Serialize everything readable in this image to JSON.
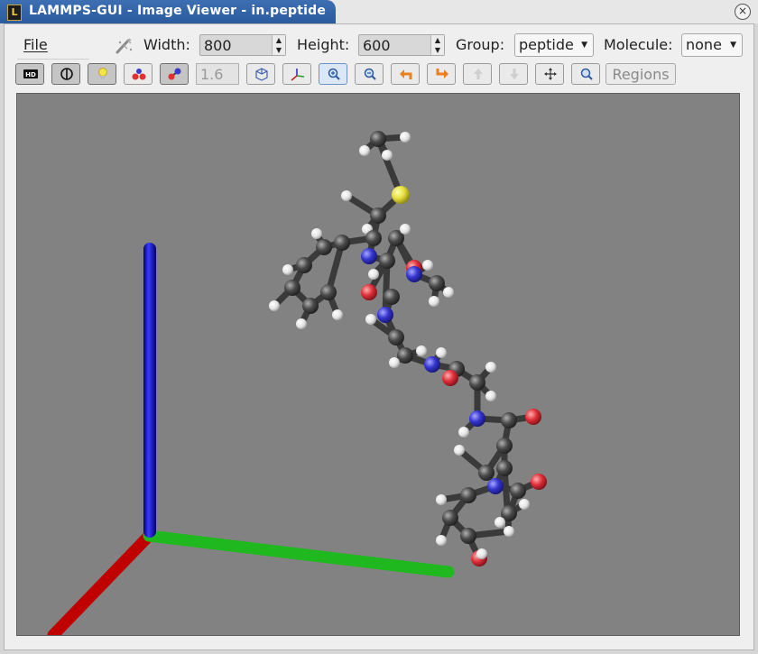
{
  "window": {
    "title": "LAMMPS-GUI - Image Viewer - in.peptide",
    "app_icon_text": "L",
    "close_glyph": "×"
  },
  "menu": {
    "file_label": "File"
  },
  "settings": {
    "width_label": "Width:",
    "width_value": "800",
    "height_label": "Height:",
    "height_value": "600",
    "group_label": "Group:",
    "group_value": "peptide",
    "molecule_label": "Molecule:",
    "molecule_value": "none"
  },
  "toolbar": {
    "buttons": [
      {
        "name": "hd-toggle",
        "icon": "hd-icon",
        "state": "on"
      },
      {
        "name": "shiny-toggle",
        "icon": "half-circle-icon",
        "state": "on"
      },
      {
        "name": "light-toggle",
        "icon": "lightbulb-icon",
        "state": "on"
      },
      {
        "name": "vdw-toggle",
        "icon": "atoms-icon",
        "state": "off"
      },
      {
        "name": "bond-toggle",
        "icon": "bonds-icon",
        "state": "on"
      },
      {
        "name": "box-toggle",
        "icon": "box-icon",
        "state": "off"
      },
      {
        "name": "axes-toggle",
        "icon": "axes-icon",
        "state": "off"
      },
      {
        "name": "zoom-in",
        "icon": "zoom-in-icon",
        "state": "focus"
      },
      {
        "name": "zoom-out",
        "icon": "zoom-out-icon",
        "state": "off"
      },
      {
        "name": "rotate-left",
        "icon": "rotate-left-icon",
        "state": "off"
      },
      {
        "name": "rotate-right",
        "icon": "rotate-right-icon",
        "state": "off"
      },
      {
        "name": "rotate-up",
        "icon": "rotate-up-icon",
        "state": "disabled"
      },
      {
        "name": "rotate-down",
        "icon": "rotate-down-icon",
        "state": "disabled"
      },
      {
        "name": "recenter",
        "icon": "move-icon",
        "state": "off"
      },
      {
        "name": "reset-view",
        "icon": "magnifier-reset-icon",
        "state": "off"
      }
    ],
    "bond_scale_value": "1.6",
    "regions_label": "Regions"
  },
  "colors": {
    "viewport_bg": "#828282",
    "title_blue": "#2f5fa3",
    "axis_x": "#d40000",
    "axis_y": "#1fc21f",
    "axis_z": "#0000e0",
    "carbon": "#4a4a4a",
    "hydrogen": "#f0f0f0",
    "oxygen": "#e0303a",
    "nitrogen": "#3535d0",
    "sulfur": "#e8e040"
  }
}
